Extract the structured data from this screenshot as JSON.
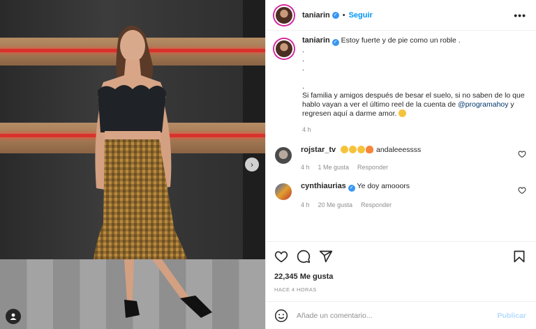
{
  "post": {
    "username": "taniarin",
    "follow_label": "Seguir",
    "more_icon": "more-horizontal-icon"
  },
  "caption": {
    "username": "taniarin",
    "line1": "Estoy fuerte y de pie como un roble .",
    "dots": [
      ".",
      ".",
      ".",
      "."
    ],
    "line2": "Si familia y amigos después de besar el suelo, si no saben de lo que hablo vayan a ver el último reel de la cuenta de",
    "mention": "@programahoy",
    "line3": " y regresen aquí a darme amor.",
    "time": "4 h"
  },
  "comments": [
    {
      "username": "rojstar_tv",
      "emojis": [
        "heart-eyes",
        "heart-eyes",
        "heart-eyes",
        "fire"
      ],
      "text": "andaleeessss",
      "time": "4 h",
      "likes": "1 Me gusta",
      "reply": "Responder"
    },
    {
      "username": "cynthiaurias",
      "text": "Ye doy amooors",
      "time": "4 h",
      "likes": "20 Me gusta",
      "reply": "Responder"
    }
  ],
  "stats": {
    "likes": "22,345 Me gusta",
    "ago": "HACE 4 HORAS"
  },
  "composer": {
    "placeholder": "Añade un comentario...",
    "publish": "Publicar"
  },
  "colors": {
    "accent": "#0095f6",
    "verified": "#3897f0",
    "muted": "#8e8e8e"
  }
}
